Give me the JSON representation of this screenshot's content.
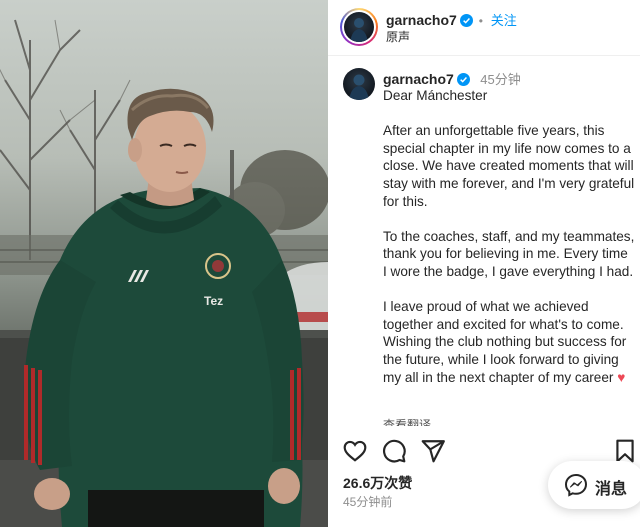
{
  "header": {
    "username": "garnacho7",
    "follow_label": "关注",
    "separator": "•",
    "audio_label": "原声"
  },
  "caption": {
    "username": "garnacho7",
    "time_ago": "45分钟",
    "greeting": "Dear Mánchester",
    "paragraphs": [
      "After an unforgettable five years, this special chapter in my life now comes to a close. We have created moments that will stay with me forever, and I'm very grateful for this.",
      "To the coaches, staff, and my teammates, thank you for believing in me. Every time I wore the badge, I gave everything I had.",
      "I leave proud of what we achieved together and excited for what's to come. Wishing the club nothing but success for the future, while I look forward to giving my all in the next chapter of my career"
    ],
    "heart_emoji": "♥",
    "translate_label": "查看翻译"
  },
  "actions": {
    "icons": [
      "heart-outline-icon",
      "comment-icon",
      "share-icon",
      "bookmark-icon"
    ]
  },
  "stats": {
    "likes": "26.6万次赞",
    "posted_ago": "45分钟前"
  },
  "message_button": {
    "label": "消息"
  },
  "colors": {
    "link_blue": "#0095f6",
    "verified_blue": "#0095f6",
    "heart_red": "#ed4956",
    "text_primary": "#262626",
    "text_secondary": "#8e8e8e"
  }
}
